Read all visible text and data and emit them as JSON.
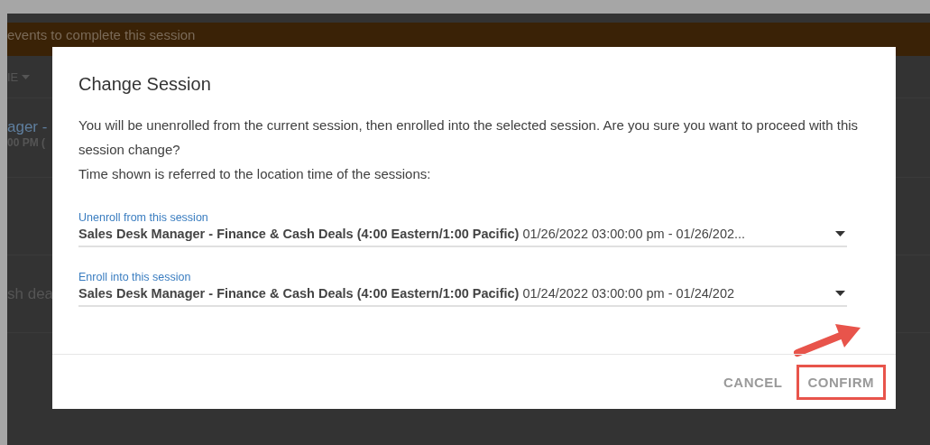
{
  "background_page": {
    "banner": "events to complete this session",
    "filter_label": "IE",
    "row_title": "ager -",
    "row_time": "00 PM (",
    "row_text": "sh dea"
  },
  "dialog": {
    "title": "Change Session",
    "message": [
      "You will be unenrolled from the current session, then enrolled into the selected session. Are you sure you want to proceed with this session change?",
      "Time shown is referred to the location time of the sessions:"
    ],
    "fields": [
      {
        "label": "Unenroll from this session",
        "value": "**Sales Desk Manager - Finance & Cash Deals (4:00 Eastern/1:00 Pacific)** 01/26/2022 03:00:00 pm - 01/26/202..."
      },
      {
        "label": "Enroll into this session",
        "value": "**Sales Desk Manager - Finance & Cash Deals (4:00 Eastern/1:00 Pacific)** 01/24/2022 03:00:00 pm - 01/24/202"
      }
    ],
    "buttons": [
      {
        "label": "CANCEL",
        "highlighted": false
      },
      {
        "label": "CONFIRM",
        "highlighted": true
      }
    ]
  }
}
